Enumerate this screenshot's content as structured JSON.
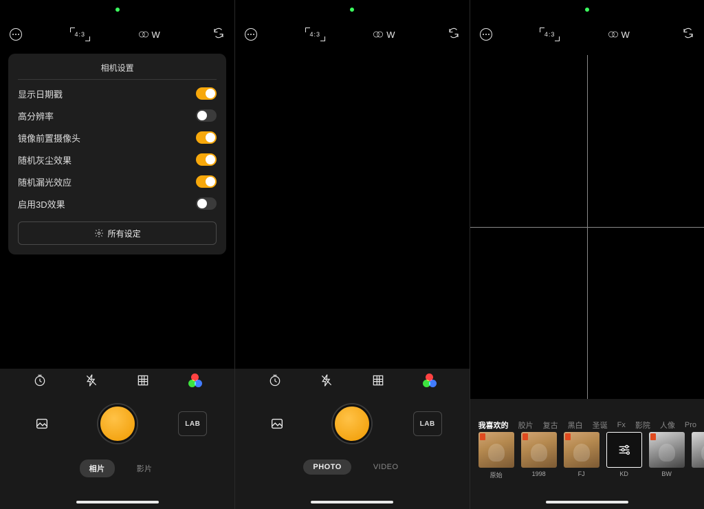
{
  "topbar": {
    "aspect_label": "4:3",
    "lens_label": "W"
  },
  "settings": {
    "title": "相机设置",
    "items": [
      {
        "label": "显示日期戳",
        "on": true
      },
      {
        "label": "高分辨率",
        "on": false
      },
      {
        "label": "镜像前置摄像头",
        "on": true
      },
      {
        "label": "随机灰尘效果",
        "on": true
      },
      {
        "label": "随机漏光效应",
        "on": true
      },
      {
        "label": "启用3D效果",
        "on": false
      }
    ],
    "all_settings_label": "所有设定"
  },
  "bottom": {
    "lab_label": "LAB"
  },
  "modes_screen1": {
    "active": "相片",
    "inactive": "影片"
  },
  "modes_screen2": {
    "active": "PHOTO",
    "inactive": "VIDEO"
  },
  "filter_categories": [
    {
      "label": "我喜欢的",
      "active": true
    },
    {
      "label": "胶片"
    },
    {
      "label": "复古"
    },
    {
      "label": "黑白"
    },
    {
      "label": "圣诞"
    },
    {
      "label": "Fx"
    },
    {
      "label": "影院"
    },
    {
      "label": "人像"
    },
    {
      "label": "Pro"
    }
  ],
  "filters": [
    {
      "label": "原始",
      "kind": "warm"
    },
    {
      "label": "1998",
      "kind": "warm"
    },
    {
      "label": "FJ",
      "kind": "warm"
    },
    {
      "label": "KD",
      "kind": "kd"
    },
    {
      "label": "BW",
      "kind": "bw"
    }
  ]
}
